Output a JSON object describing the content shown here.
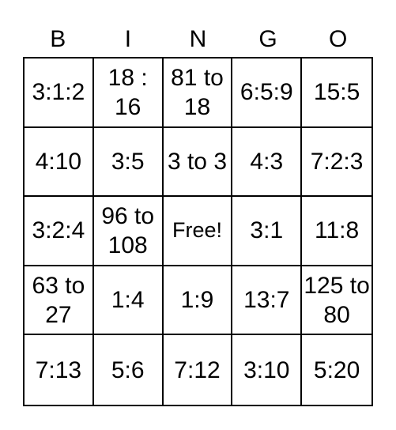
{
  "header": {
    "letters": [
      "B",
      "I",
      "N",
      "G",
      "O"
    ]
  },
  "grid": {
    "rows": [
      [
        "3:1:2",
        "18 : 16",
        "81 to 18",
        "6:5:9",
        "15:5"
      ],
      [
        "4:10",
        "3:5",
        "3 to 3",
        "4:3",
        "7:2:3"
      ],
      [
        "3:2:4",
        "96 to 108",
        "Free!",
        "3:1",
        "11:8"
      ],
      [
        "63 to 27",
        "1:4",
        "1:9",
        "13:7",
        "125 to 80"
      ],
      [
        "7:13",
        "5:6",
        "7:12",
        "3:10",
        "5:20"
      ]
    ]
  },
  "colors": {
    "line": "#000000",
    "background": "#ffffff",
    "text": "#000000"
  }
}
